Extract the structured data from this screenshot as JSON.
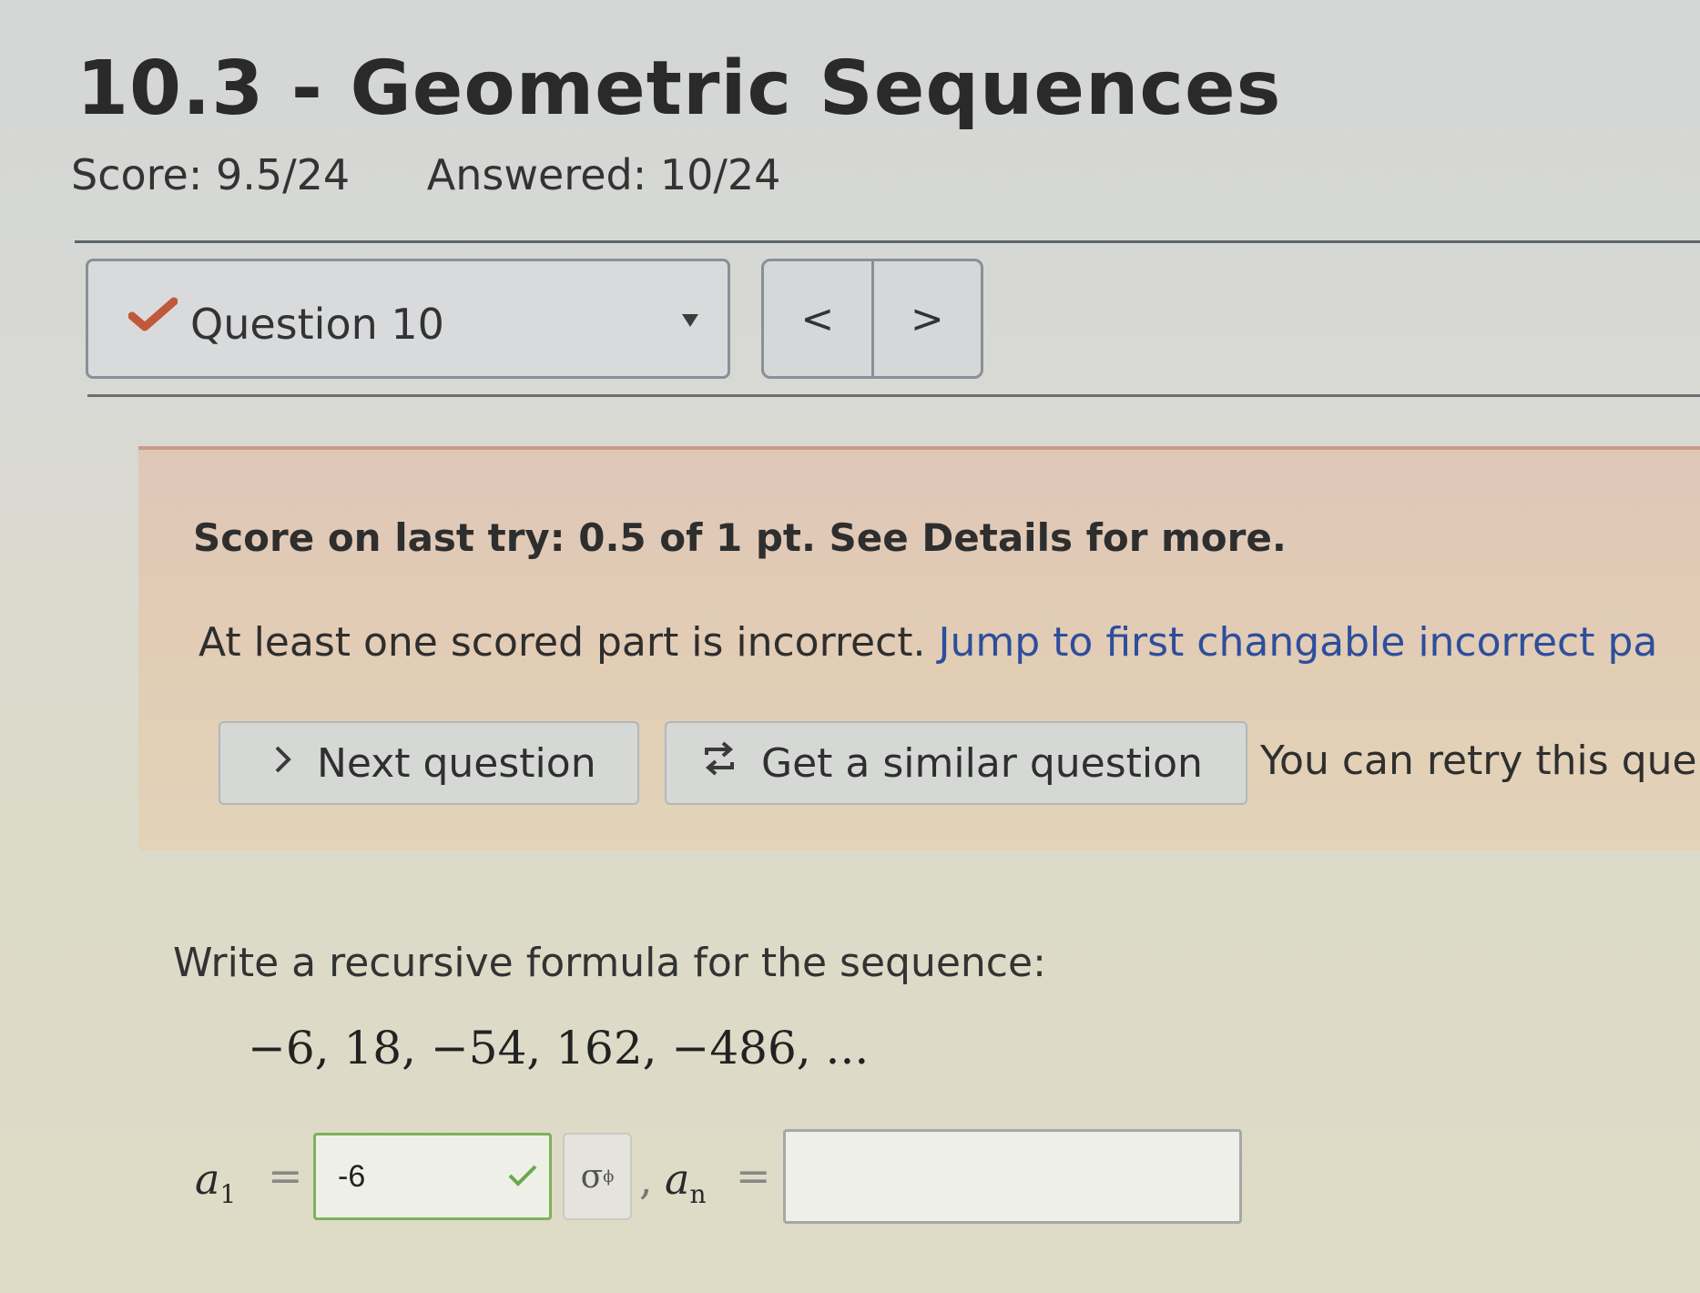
{
  "assignment": {
    "title": "10.3 - Geometric Sequences",
    "score": "Score: 9.5/24",
    "answered": "Answered: 10/24"
  },
  "question_nav": {
    "current": "Question 10",
    "prev_label": "<",
    "next_label": ">"
  },
  "feedback": {
    "score_text": "Score on last try: 0.5 of 1 pt. See Details for more.",
    "incorrect_text": "At least one scored part is incorrect.",
    "jump_link": "Jump to first changable incorrect pa",
    "next_button": "Next question",
    "similar_button": "Get a similar question",
    "retry_text": "You can retry this que"
  },
  "question": {
    "prompt": "Write a recursive formula for the sequence:",
    "sequence": "−6, 18, −54, 162, −486, ...",
    "a1_label": "a",
    "a1_sub": "1",
    "a1_value": "-6",
    "an_label": "a",
    "an_sub": "n",
    "an_value": "",
    "equals": "=",
    "comma": ","
  },
  "colors": {
    "correct_border": "#7fb15b",
    "link": "#2d4e9c",
    "feedback_bg": "#e2cdb5"
  },
  "icons": [
    "checkmark-icon",
    "chevron-down-icon",
    "chevron-left-icon",
    "chevron-right-icon",
    "retry-icon",
    "math-editor-icon"
  ]
}
